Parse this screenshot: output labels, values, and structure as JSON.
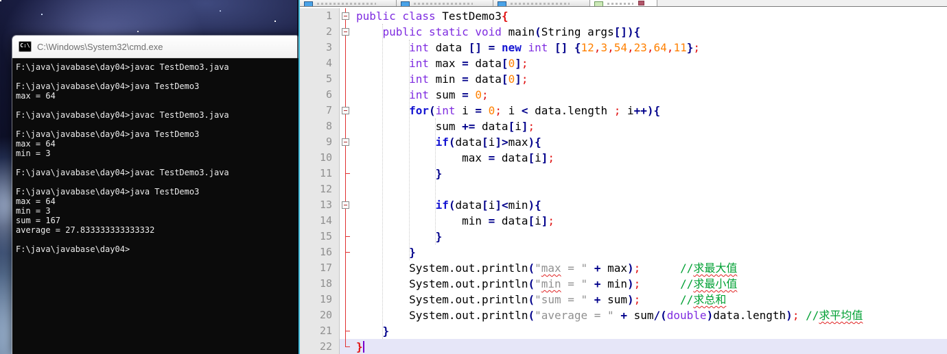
{
  "cmd": {
    "icon_label": "C:\\",
    "title": "C:\\Windows\\System32\\cmd.exe",
    "terminal_lines": [
      "F:\\java\\javabase\\day04>javac TestDemo3.java",
      "",
      "F:\\java\\javabase\\day04>java TestDemo3",
      "max = 64",
      "",
      "F:\\java\\javabase\\day04>javac TestDemo3.java",
      "",
      "F:\\java\\javabase\\day04>java TestDemo3",
      "max = 64",
      "min = 3",
      "",
      "F:\\java\\javabase\\day04>javac TestDemo3.java",
      "",
      "F:\\java\\javabase\\day04>java TestDemo3",
      "max = 64",
      "min = 3",
      "sum = 167",
      "average = 27.833333333333332",
      "",
      "F:\\java\\javabase\\day04>"
    ]
  },
  "editor": {
    "tabs": [
      {
        "id": "tab-1",
        "active": false,
        "has_close": false
      },
      {
        "id": "tab-2",
        "active": false,
        "has_close": false
      },
      {
        "id": "tab-3",
        "active": false,
        "has_close": false
      },
      {
        "id": "tab-4",
        "active": true,
        "has_close": true
      }
    ],
    "active_line": 22,
    "caret_line": 22,
    "fold_marks": {
      "1": "box",
      "2": "box",
      "7": "box",
      "9": "box",
      "13": "box",
      "11": "tick",
      "15": "tick",
      "16": "tick",
      "21": "tick",
      "22": "corner"
    },
    "code_lines": [
      {
        "n": 1,
        "segs": [
          [
            "public class ",
            "k1"
          ],
          [
            "TestDemo3",
            "pl"
          ],
          [
            "{",
            "match"
          ]
        ]
      },
      {
        "n": 2,
        "segs": [
          [
            "    ",
            "pl"
          ],
          [
            "public static void ",
            "k1"
          ],
          [
            "main",
            "pl"
          ],
          [
            "(",
            "op"
          ],
          [
            "String args",
            "pl"
          ],
          [
            "[])",
            "op"
          ],
          [
            "{",
            "op"
          ]
        ]
      },
      {
        "n": 3,
        "segs": [
          [
            "        ",
            "pl"
          ],
          [
            "int ",
            "k1"
          ],
          [
            "data ",
            "pl"
          ],
          [
            "[] = ",
            "op"
          ],
          [
            "new ",
            "k2"
          ],
          [
            "int ",
            "k1"
          ],
          [
            "[] {",
            "op"
          ],
          [
            "12",
            "num"
          ],
          [
            ",",
            "sep"
          ],
          [
            "3",
            "num"
          ],
          [
            ",",
            "sep"
          ],
          [
            "54",
            "num"
          ],
          [
            ",",
            "sep"
          ],
          [
            "23",
            "num"
          ],
          [
            ",",
            "sep"
          ],
          [
            "64",
            "num"
          ],
          [
            ",",
            "sep"
          ],
          [
            "11",
            "num"
          ],
          [
            "}",
            "op"
          ],
          [
            ";",
            "sep"
          ]
        ]
      },
      {
        "n": 4,
        "segs": [
          [
            "        ",
            "pl"
          ],
          [
            "int ",
            "k1"
          ],
          [
            "max ",
            "pl"
          ],
          [
            "= ",
            "op"
          ],
          [
            "data",
            "pl"
          ],
          [
            "[",
            "op"
          ],
          [
            "0",
            "num"
          ],
          [
            "]",
            "op"
          ],
          [
            ";",
            "sep"
          ]
        ]
      },
      {
        "n": 5,
        "segs": [
          [
            "        ",
            "pl"
          ],
          [
            "int ",
            "k1"
          ],
          [
            "min ",
            "pl"
          ],
          [
            "= ",
            "op"
          ],
          [
            "data",
            "pl"
          ],
          [
            "[",
            "op"
          ],
          [
            "0",
            "num"
          ],
          [
            "]",
            "op"
          ],
          [
            ";",
            "sep"
          ]
        ]
      },
      {
        "n": 6,
        "segs": [
          [
            "        ",
            "pl"
          ],
          [
            "int ",
            "k1"
          ],
          [
            "sum ",
            "pl"
          ],
          [
            "= ",
            "op"
          ],
          [
            "0",
            "num"
          ],
          [
            ";",
            "sep"
          ]
        ]
      },
      {
        "n": 7,
        "segs": [
          [
            "        ",
            "pl"
          ],
          [
            "for",
            "k2"
          ],
          [
            "(",
            "op"
          ],
          [
            "int ",
            "k1"
          ],
          [
            "i ",
            "pl"
          ],
          [
            "= ",
            "op"
          ],
          [
            "0",
            "num"
          ],
          [
            ";",
            "sep"
          ],
          [
            " i ",
            "pl"
          ],
          [
            "< ",
            "op"
          ],
          [
            "data.length ",
            "pl"
          ],
          [
            ";",
            "sep"
          ],
          [
            " i",
            "pl"
          ],
          [
            "++){",
            "op"
          ]
        ]
      },
      {
        "n": 8,
        "segs": [
          [
            "            sum ",
            "pl"
          ],
          [
            "+= ",
            "op"
          ],
          [
            "data",
            "pl"
          ],
          [
            "[",
            "op"
          ],
          [
            "i",
            "pl"
          ],
          [
            "]",
            "op"
          ],
          [
            ";",
            "sep"
          ]
        ]
      },
      {
        "n": 9,
        "segs": [
          [
            "            ",
            "pl"
          ],
          [
            "if",
            "k2"
          ],
          [
            "(",
            "op"
          ],
          [
            "data",
            "pl"
          ],
          [
            "[",
            "op"
          ],
          [
            "i",
            "pl"
          ],
          [
            "]>",
            "op"
          ],
          [
            "max",
            "pl"
          ],
          [
            "){",
            "op"
          ]
        ]
      },
      {
        "n": 10,
        "segs": [
          [
            "                max ",
            "pl"
          ],
          [
            "= ",
            "op"
          ],
          [
            "data",
            "pl"
          ],
          [
            "[",
            "op"
          ],
          [
            "i",
            "pl"
          ],
          [
            "]",
            "op"
          ],
          [
            ";",
            "sep"
          ]
        ]
      },
      {
        "n": 11,
        "segs": [
          [
            "            ",
            "pl"
          ],
          [
            "}",
            "op"
          ]
        ]
      },
      {
        "n": 12,
        "segs": []
      },
      {
        "n": 13,
        "segs": [
          [
            "            ",
            "pl"
          ],
          [
            "if",
            "k2"
          ],
          [
            "(",
            "op"
          ],
          [
            "data",
            "pl"
          ],
          [
            "[",
            "op"
          ],
          [
            "i",
            "pl"
          ],
          [
            "]<",
            "op"
          ],
          [
            "min",
            "pl"
          ],
          [
            "){",
            "op"
          ]
        ]
      },
      {
        "n": 14,
        "segs": [
          [
            "                min ",
            "pl"
          ],
          [
            "= ",
            "op"
          ],
          [
            "data",
            "pl"
          ],
          [
            "[",
            "op"
          ],
          [
            "i",
            "pl"
          ],
          [
            "]",
            "op"
          ],
          [
            ";",
            "sep"
          ]
        ]
      },
      {
        "n": 15,
        "segs": [
          [
            "            ",
            "pl"
          ],
          [
            "}",
            "op"
          ]
        ]
      },
      {
        "n": 16,
        "segs": [
          [
            "        ",
            "pl"
          ],
          [
            "}",
            "op"
          ]
        ]
      },
      {
        "n": 17,
        "segs": [
          [
            "        System.out.println",
            "pl"
          ],
          [
            "(",
            "op"
          ],
          [
            "\"",
            "str"
          ],
          [
            "max",
            "strU"
          ],
          [
            " = \"",
            "str"
          ],
          [
            " ",
            "pl"
          ],
          [
            "+",
            "op"
          ],
          [
            " max",
            "pl"
          ],
          [
            ")",
            "op"
          ],
          [
            ";",
            "sep"
          ],
          [
            "      ",
            "pl"
          ],
          [
            "//",
            "com"
          ],
          [
            "求最大值",
            "comU"
          ]
        ]
      },
      {
        "n": 18,
        "segs": [
          [
            "        System.out.println",
            "pl"
          ],
          [
            "(",
            "op"
          ],
          [
            "\"",
            "str"
          ],
          [
            "min",
            "strU"
          ],
          [
            " = \"",
            "str"
          ],
          [
            " ",
            "pl"
          ],
          [
            "+",
            "op"
          ],
          [
            " min",
            "pl"
          ],
          [
            ")",
            "op"
          ],
          [
            ";",
            "sep"
          ],
          [
            "      ",
            "pl"
          ],
          [
            "//",
            "com"
          ],
          [
            "求最小值",
            "comU"
          ]
        ]
      },
      {
        "n": 19,
        "segs": [
          [
            "        System.out.println",
            "pl"
          ],
          [
            "(",
            "op"
          ],
          [
            "\"sum = \"",
            "str"
          ],
          [
            " ",
            "pl"
          ],
          [
            "+",
            "op"
          ],
          [
            " sum",
            "pl"
          ],
          [
            ")",
            "op"
          ],
          [
            ";",
            "sep"
          ],
          [
            "      ",
            "pl"
          ],
          [
            "//",
            "com"
          ],
          [
            "求总和",
            "comU"
          ]
        ]
      },
      {
        "n": 20,
        "segs": [
          [
            "        System.out.println",
            "pl"
          ],
          [
            "(",
            "op"
          ],
          [
            "\"average = \"",
            "str"
          ],
          [
            " ",
            "pl"
          ],
          [
            "+",
            "op"
          ],
          [
            " sum",
            "pl"
          ],
          [
            "/(",
            "op"
          ],
          [
            "double",
            "k1"
          ],
          [
            ")",
            "op"
          ],
          [
            "data.length",
            "pl"
          ],
          [
            ")",
            "op"
          ],
          [
            ";",
            "sep"
          ],
          [
            " ",
            "pl"
          ],
          [
            "//",
            "com"
          ],
          [
            "求平均值",
            "comU"
          ]
        ]
      },
      {
        "n": 21,
        "segs": [
          [
            "    ",
            "pl"
          ],
          [
            "}",
            "op"
          ]
        ]
      },
      {
        "n": 22,
        "segs": [
          [
            "}",
            "match"
          ]
        ]
      }
    ]
  },
  "colors": {
    "keyword_type": "#7e2be0",
    "keyword_flow": "#1414d2",
    "operator": "#00008b",
    "number": "#ff8000",
    "separator": "#e01010",
    "string": "#909090",
    "comment": "#00a033",
    "brace_match": "#e01010",
    "active_line_bg": "#e6e6f8",
    "fold_line": "#e03030",
    "gutter_bg": "#e7e7e7",
    "terminal_bg": "#0b0b0b",
    "terminal_text": "#ececec",
    "editor_edge": "#45c0dd"
  }
}
